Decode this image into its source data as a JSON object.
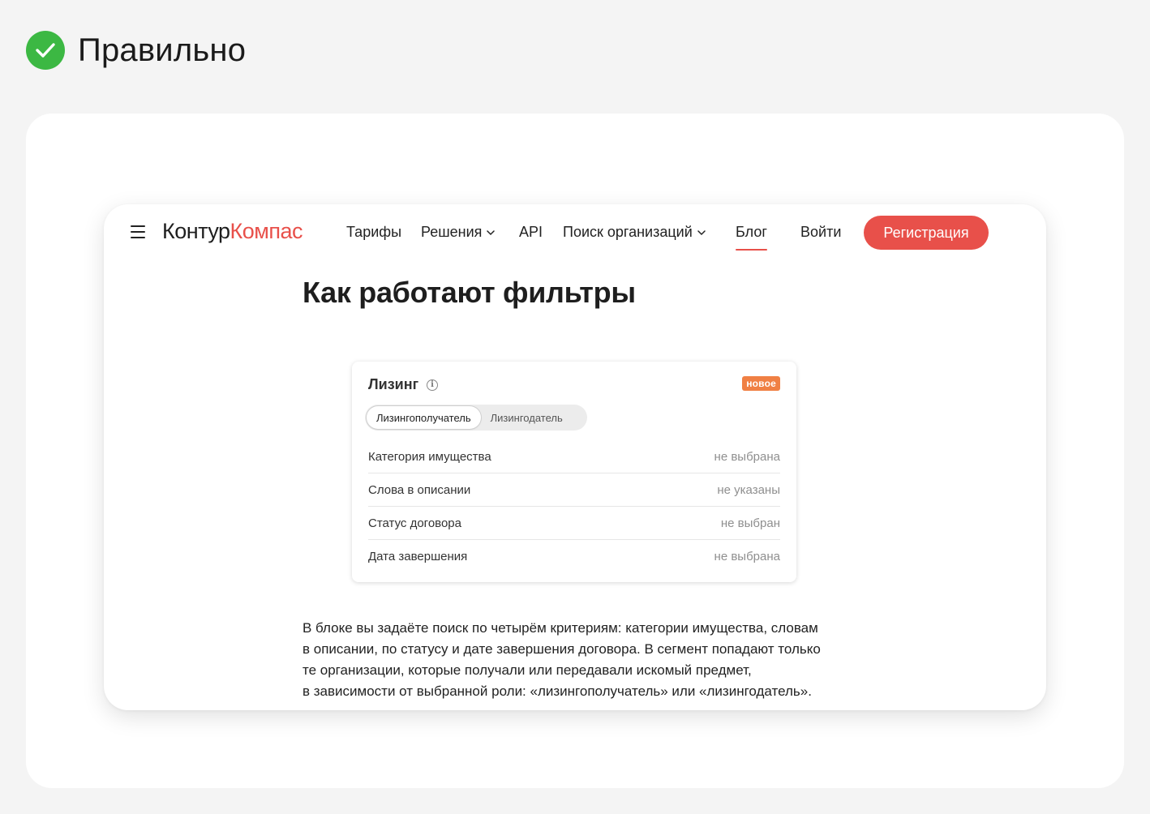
{
  "header": {
    "title": "Правильно",
    "icon": "check-circle-icon",
    "icon_color": "#3cb843"
  },
  "nav": {
    "menu_icon": "hamburger-icon",
    "logo_part1": "Контур",
    "logo_part2": "Компас",
    "items": [
      {
        "label": "Тарифы"
      },
      {
        "label": "Решения"
      },
      {
        "label": "API"
      },
      {
        "label": "Поиск организаций"
      },
      {
        "label": "Блог"
      },
      {
        "label": "Войти"
      }
    ],
    "register_label": "Регистрация",
    "accent_color": "#e8504a"
  },
  "page": {
    "title": "Как работают фильтры"
  },
  "filter": {
    "title": "Лизинг",
    "badge": "новое",
    "badge_color": "#f08044",
    "roles": [
      {
        "label": "Лизингополучатель",
        "active": true
      },
      {
        "label": "Лизингодатель",
        "active": false
      }
    ],
    "rows": [
      {
        "label": "Категория имущества",
        "value": "не выбрана"
      },
      {
        "label": "Слова в описании",
        "value": "не указаны"
      },
      {
        "label": "Статус договора",
        "value": "не выбран"
      },
      {
        "label": "Дата завершения",
        "value": "не выбрана"
      }
    ]
  },
  "description": {
    "lines": [
      "В блоке вы задаёте поиск по четырём критериям: категории имущества, словам",
      "в описании, по статусу и дате завершения договора. В сегмент попадают только",
      "те организации, которые получали или передавали искомый предмет,",
      "в зависимости от выбранной роли: «лизингополучатель» или «лизингодатель»."
    ]
  }
}
